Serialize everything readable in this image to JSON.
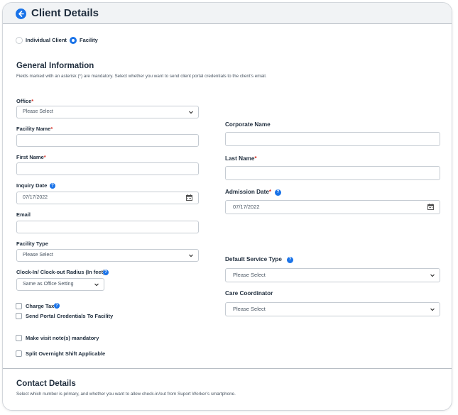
{
  "header": {
    "title": "Client Details"
  },
  "client_type": {
    "options": [
      {
        "label": "Individual Client",
        "selected": false
      },
      {
        "label": "Facility",
        "selected": true
      }
    ]
  },
  "general": {
    "title": "General Information",
    "description": "Fields marked with an asterisk (*) are mandatory. Select whether you want to send client portal credentials to the client’s email."
  },
  "fields": {
    "office": {
      "label": "Office",
      "required": "*",
      "value": "Please Select"
    },
    "facility_name": {
      "label": "Facility Name",
      "required": "*",
      "value": ""
    },
    "corporate_name": {
      "label": "Corporate Name",
      "value": ""
    },
    "first_name": {
      "label": "First Name",
      "required": "*",
      "value": ""
    },
    "last_name": {
      "label": "Last Name",
      "required": "*",
      "value": ""
    },
    "inquiry_date": {
      "label": "Inquiry Date",
      "value": "07/17/2022"
    },
    "admission_date": {
      "label": "Admission Date",
      "required": "*",
      "value": "07/17/2022"
    },
    "email": {
      "label": "Email",
      "value": ""
    },
    "facility_type": {
      "label": "Facility Type",
      "value": "Please Select"
    },
    "default_service_type": {
      "label": "Default Service Type",
      "value": "Please Select"
    },
    "clock_radius": {
      "label": "Clock-In/ Clock-out Radius (In feet)",
      "value": "Same as Office Setting"
    },
    "care_coordinator": {
      "label": "Care Coordinator",
      "value": "Please Select"
    }
  },
  "checkboxes": {
    "charge_tax": {
      "label": "Charge Tax",
      "checked": false
    },
    "send_portal": {
      "label": "Send Portal Credentials To Facility",
      "checked": false
    },
    "visit_notes": {
      "label": "Make visit note(s) mandatory",
      "checked": false
    },
    "split_shift": {
      "label": "Split Overnight Shift Applicable",
      "checked": false
    }
  },
  "contact": {
    "title": "Contact Details",
    "description": "Select which number is primary, and whether you want to allow check-in/out from Suport Worker’s smartphone."
  },
  "colors": {
    "accent": "#1a73e8",
    "required": "#d93025",
    "header_bg": "#f1f3f5"
  },
  "icons": {
    "back": "arrow-left-circle-icon",
    "help": "question-circle-icon",
    "calendar": "calendar-icon",
    "chevron": "chevron-down-icon"
  }
}
